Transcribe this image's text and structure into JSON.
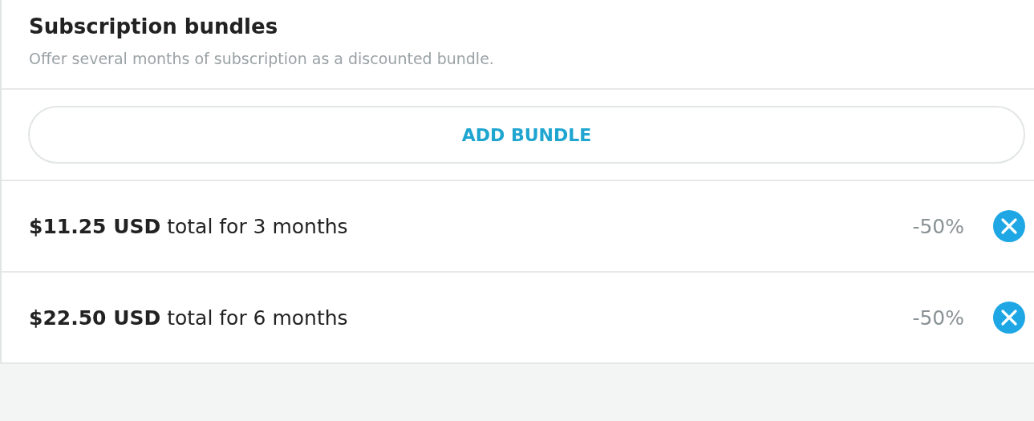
{
  "section": {
    "title": "Subscription bundles",
    "description": "Offer several months of subscription as a discounted bundle."
  },
  "add_button": {
    "label": "ADD BUNDLE"
  },
  "bundles": [
    {
      "summary": "**$11.25 USD** total for 3 months",
      "discount": "-50%"
    },
    {
      "summary": "**$22.50 USD** total for 6 months",
      "discount": "-50%"
    }
  ]
}
